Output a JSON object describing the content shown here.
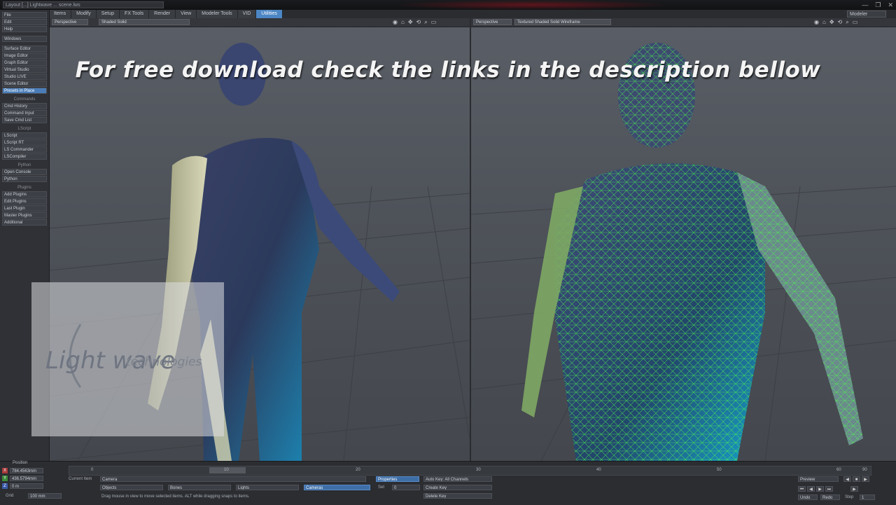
{
  "window": {
    "doc_title": "Layout [...] Lightwave ... scene.lws",
    "controls": [
      "—",
      "❐",
      "✕"
    ]
  },
  "tabs": [
    {
      "label": "Items",
      "active": false
    },
    {
      "label": "Modify",
      "active": false
    },
    {
      "label": "Setup",
      "active": false
    },
    {
      "label": "FX Tools",
      "active": false
    },
    {
      "label": "Render",
      "active": false
    },
    {
      "label": "View",
      "active": false
    },
    {
      "label": "Modeler Tools",
      "active": false
    },
    {
      "label": "VID",
      "active": false
    },
    {
      "label": "Utilities",
      "active": true
    }
  ],
  "layout_menu": "Modeler",
  "sidebar": {
    "top_items": [
      "File",
      "Edit",
      "Help"
    ],
    "windows": "Windows",
    "editors": [
      "Surface Editor",
      "Image Editor",
      "Graph Editor",
      "Virtual Studio",
      "Studio LIVE",
      "Scene Editor",
      "Presets in Place"
    ],
    "sections": [
      {
        "title": "Commands",
        "items": [
          "Cmd History",
          "Command Input",
          "Save Cmd List"
        ]
      },
      {
        "title": "LScript",
        "items": [
          "LScript",
          "LScript RT",
          "LS Commander",
          "LSCompiler"
        ]
      },
      {
        "title": "Python",
        "items": [
          "Open Console",
          "Python"
        ]
      },
      {
        "title": "Plugins",
        "items": [
          "Add Plugins",
          "Edit Plugins",
          "Last Plugin",
          "Master Plugins",
          "Additional"
        ]
      }
    ]
  },
  "viewports": {
    "left": {
      "view": "Perspective",
      "mode": "Shaded Solid"
    },
    "right": {
      "view": "Perspective",
      "mode": "Textured Shaded Solid Wireframe"
    },
    "icons": [
      "◉",
      "⌂",
      "✥",
      "⟲",
      "⌕",
      "▭"
    ]
  },
  "overlay_text": "For free download check the links in the description bellow",
  "logo": {
    "main": "Light wave",
    "sub": "technologies"
  },
  "timeline": {
    "ticks": [
      "0",
      "10",
      "20",
      "30",
      "40",
      "50",
      "60",
      "90"
    ],
    "position_label": "Position",
    "x_value": "784.4563mm",
    "y_value": "436.5794mm",
    "z_value": "0 m",
    "grid_label": "Grid",
    "grid_value": "100 mm",
    "current_item_label": "Current Item",
    "current_item_value": "Camera",
    "buttons": [
      "Objects",
      "Bones",
      "Lights",
      "Cameras"
    ],
    "properties": "Properties",
    "set_label": "Set",
    "set_value": "0",
    "autokey": "Auto Key: All Channels",
    "create_key": "Create Key",
    "delete_key": "Delete Key",
    "hint": "Drag mouse in view to move selected items. ALT while dragging snaps to items.",
    "preview": "Preview",
    "step_label": "Step",
    "step_value": "1",
    "undo": "Undo",
    "redo": "Redo"
  }
}
